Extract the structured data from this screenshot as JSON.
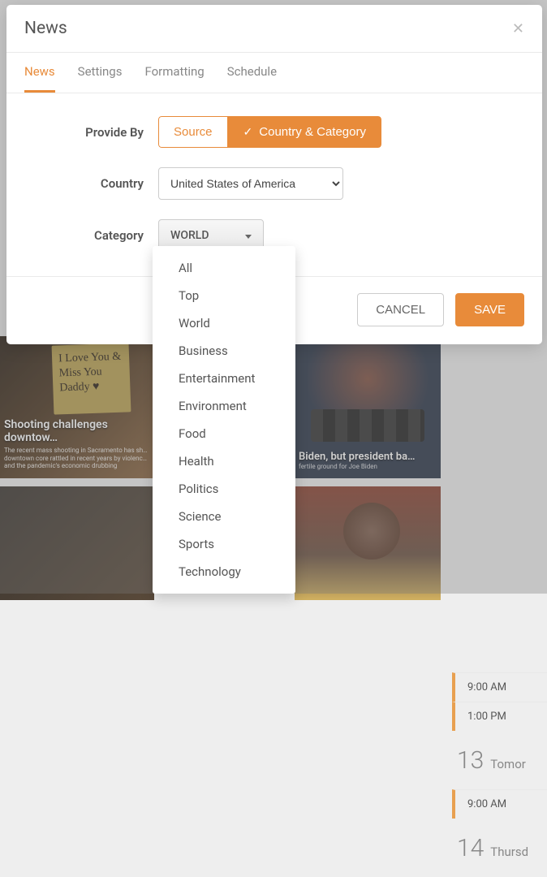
{
  "modal": {
    "title": "News",
    "tabs": [
      "News",
      "Settings",
      "Formatting",
      "Schedule"
    ],
    "active_tab_index": 0,
    "form": {
      "provide_by_label": "Provide By",
      "toggle_source": "Source",
      "toggle_country_category": "Country & Category",
      "country_label": "Country",
      "country_value": "United States of America",
      "category_label": "Category",
      "category_trigger": "WORLD"
    },
    "category_options": [
      "All",
      "Top",
      "World",
      "Business",
      "Entertainment",
      "Environment",
      "Food",
      "Health",
      "Politics",
      "Science",
      "Sports",
      "Technology"
    ],
    "footer": {
      "cancel": "CANCEL",
      "save": "SAVE"
    }
  },
  "background": {
    "card1_note": "I Love You & Miss You Daddy ♥",
    "card1_headline": "Shooting challenges downtow…",
    "card1_sub": "The recent mass shooting in Sacramento has sh… downtown core rattled in recent years by violenc… and the pandemic's economic drubbing",
    "card2_headline": "Biden, but president ba…",
    "card2_sub": "fertile ground for Joe Biden",
    "timeline": {
      "time1": "9:00 AM",
      "time2": "1:00 PM",
      "date1_num": "13",
      "date1_day": "Tomor",
      "time3": "9:00 AM",
      "date2_num": "14",
      "date2_day": "Thursd"
    }
  }
}
